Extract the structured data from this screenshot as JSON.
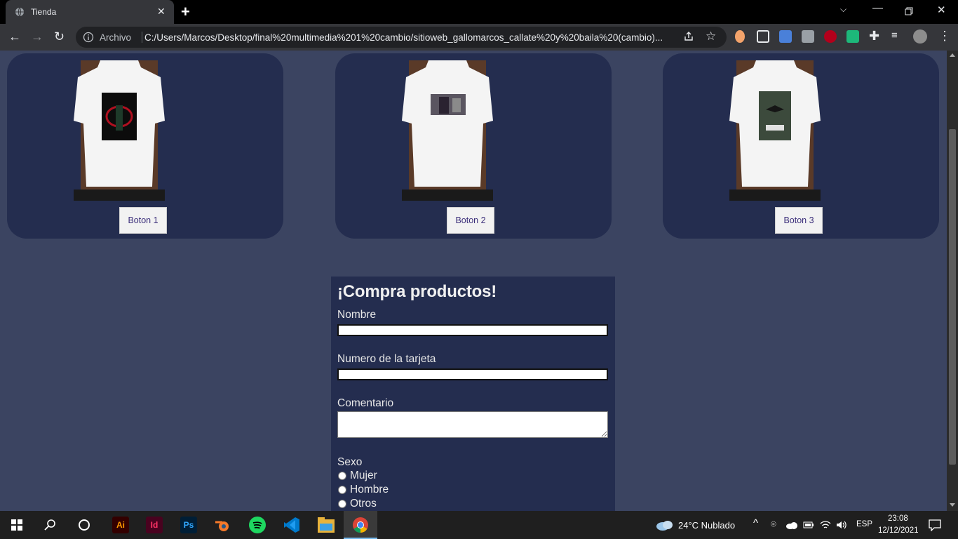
{
  "browser": {
    "tab_title": "Tienda",
    "address_prefix": "Archivo",
    "url": "C:/Users/Marcos/Desktop/final%20multimedia%201%20cambio/sitioweb_gallomarcos_callate%20y%20baila%20(cambio)..."
  },
  "products": [
    {
      "button_label": "Boton 1",
      "print_color": "#b01020"
    },
    {
      "button_label": "Boton 2",
      "print_color": "#4a3f55"
    },
    {
      "button_label": "Boton 3",
      "print_color": "#3c4a3c"
    }
  ],
  "form": {
    "title": "¡Compra productos!",
    "name_label": "Nombre",
    "card_label": "Numero de la tarjeta",
    "comment_label": "Comentario",
    "sex_label": "Sexo",
    "sex_options": [
      "Mujer",
      "Hombre",
      "Otros"
    ]
  },
  "taskbar": {
    "weather": "24°C  Nublado",
    "language": "ESP",
    "time": "23:08",
    "date": "12/12/2021",
    "apps": [
      "Ai",
      "Id",
      "Ps"
    ]
  },
  "colors": {
    "page_bg": "#3b4461",
    "card_bg": "#242d4f"
  }
}
